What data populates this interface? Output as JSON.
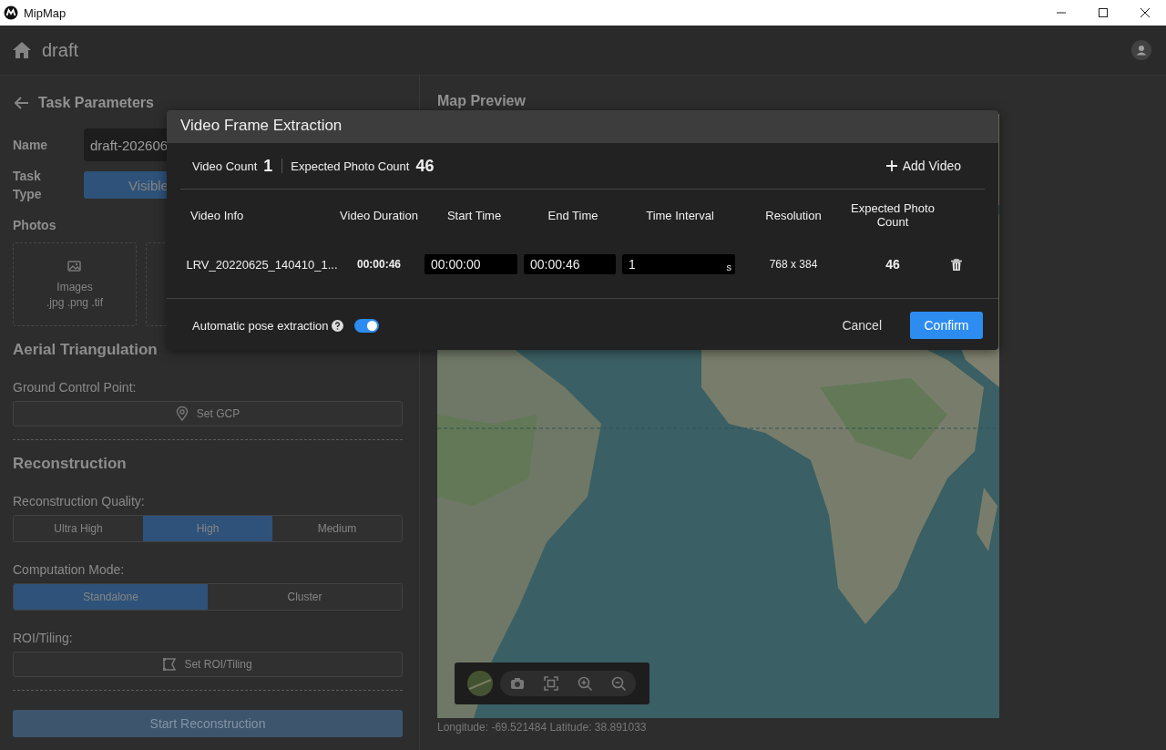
{
  "window": {
    "title": "MipMap"
  },
  "header": {
    "title": "draft"
  },
  "task_parameters": {
    "title": "Task Parameters",
    "name": {
      "label": "Name",
      "value": "draft-202606"
    },
    "task_type": {
      "label": "Task Type",
      "options": [
        {
          "label": "Visible",
          "selected": true
        }
      ]
    },
    "photos": {
      "label": "Photos",
      "sources": [
        {
          "title": "Images",
          "formats": ".jpg .png .tif"
        }
      ]
    }
  },
  "aerial_triangulation": {
    "title": "Aerial Triangulation",
    "gcp_label": "Ground Control Point:",
    "gcp_button": "Set GCP"
  },
  "reconstruction": {
    "title": "Reconstruction",
    "quality": {
      "label": "Reconstruction Quality:",
      "options": [
        {
          "label": "Ultra High",
          "selected": false
        },
        {
          "label": "High",
          "selected": true
        },
        {
          "label": "Medium",
          "selected": false
        }
      ]
    },
    "computation_mode": {
      "label": "Computation Mode:",
      "options": [
        {
          "label": "Standalone",
          "selected": true
        },
        {
          "label": "Cluster",
          "selected": false
        }
      ]
    },
    "roi": {
      "label": "ROI/Tiling:",
      "button": "Set ROI/Tiling"
    },
    "start_button": {
      "label": "Start Reconstruction",
      "disabled": true
    }
  },
  "map_preview": {
    "title": "Map Preview",
    "coordinates": "Longitude: -69.521484 Latitude: 38.891033"
  },
  "dialog": {
    "title": "Video Frame Extraction",
    "video_count": {
      "label": "Video Count",
      "value": "1"
    },
    "expected_photo_count": {
      "label": "Expected Photo Count",
      "value": "46"
    },
    "add_video": "Add Video",
    "columns": [
      "Video Info",
      "Video Duration",
      "Start Time",
      "End Time",
      "Time Interval",
      "Resolution",
      "Expected Photo Count"
    ],
    "rows": [
      {
        "video_info": "LRV_20220625_140410_1...",
        "duration": "00:00:46",
        "start_time": "00:00:00",
        "end_time": "00:00:46",
        "time_interval": "1",
        "interval_unit": "s",
        "resolution": "768 x 384",
        "expected_photo_count": "46"
      }
    ],
    "auto_pose": {
      "label": "Automatic pose extraction",
      "on": true
    },
    "buttons": [
      {
        "label": "Cancel",
        "kind": "text"
      },
      {
        "label": "Confirm",
        "kind": "primary"
      }
    ]
  }
}
